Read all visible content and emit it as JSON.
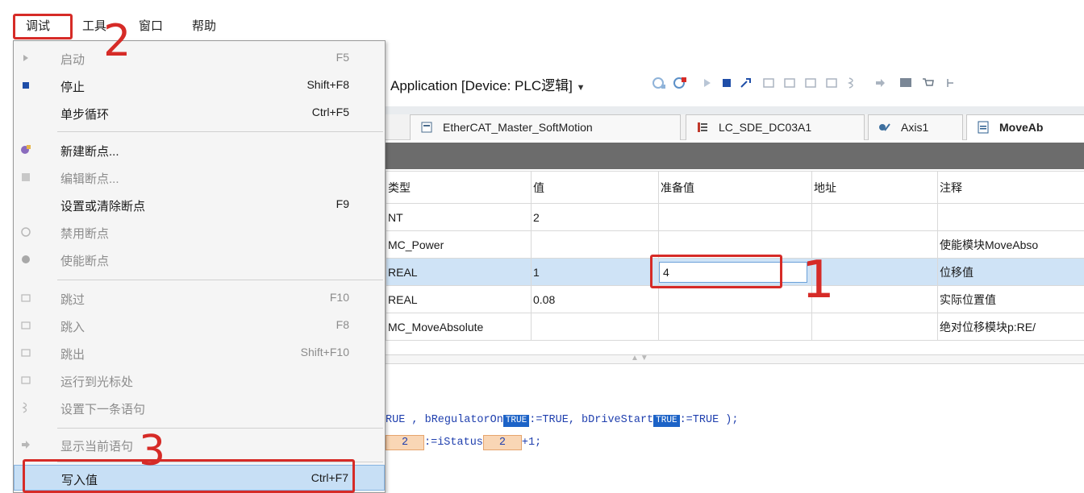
{
  "menubar": {
    "items": [
      "调试",
      "工具",
      "窗口",
      "帮助"
    ]
  },
  "toolbar": {
    "app_label": "Application [Device: PLC逻辑]"
  },
  "tabs": [
    {
      "label": "EtherCAT_Master_SoftMotion"
    },
    {
      "label": "LC_SDE_DC03A1"
    },
    {
      "label": "Axis1"
    },
    {
      "label": "MoveAb"
    }
  ],
  "watch": {
    "headers": [
      "类型",
      "值",
      "准备值",
      "地址",
      "注释"
    ],
    "rows": [
      {
        "type": "NT",
        "value": "2",
        "prepared": "",
        "address": "",
        "comment": ""
      },
      {
        "type": "MC_Power",
        "value": "",
        "prepared": "",
        "address": "",
        "comment": "使能模块MoveAbso"
      },
      {
        "type": "REAL",
        "value": "1",
        "prepared": "4",
        "address": "",
        "comment": "位移值"
      },
      {
        "type": "REAL",
        "value": "0.08",
        "prepared": "",
        "address": "",
        "comment": "实际位置值"
      },
      {
        "type": "MC_MoveAbsolute",
        "value": "",
        "prepared": "",
        "address": "",
        "comment": "绝对位移模块p:RE/"
      }
    ]
  },
  "code": {
    "line1_a": "RUE , bRegulatorOn",
    "line1_tag1": "TRUE",
    "line1_b": ":=TRUE, bDriveStart",
    "line1_tag2": "TRUE",
    "line1_c": ":=TRUE );",
    "line2_val1": "2",
    "line2_mid": ":=iStatus",
    "line2_val2": "2",
    "line2_end": "+1;"
  },
  "dropdown": {
    "items": [
      {
        "label": "启动",
        "shortcut": "F5",
        "disabled": true,
        "icon": "play-icon"
      },
      {
        "label": "停止",
        "shortcut": "Shift+F8",
        "disabled": false,
        "icon": "stop-icon"
      },
      {
        "label": "单步循环",
        "shortcut": "Ctrl+F5",
        "disabled": false,
        "icon": ""
      },
      {
        "label": "新建断点...",
        "shortcut": "",
        "disabled": false,
        "icon": "new-breakpoint-icon"
      },
      {
        "label": "编辑断点...",
        "shortcut": "",
        "disabled": true,
        "icon": "edit-breakpoint-icon"
      },
      {
        "label": "设置或清除断点",
        "shortcut": "F9",
        "disabled": false,
        "icon": ""
      },
      {
        "label": "禁用断点",
        "shortcut": "",
        "disabled": true,
        "icon": "disable-breakpoint-icon"
      },
      {
        "label": "使能断点",
        "shortcut": "",
        "disabled": true,
        "icon": "enable-breakpoint-icon"
      },
      {
        "label": "跳过",
        "shortcut": "F10",
        "disabled": true,
        "icon": "step-over-icon"
      },
      {
        "label": "跳入",
        "shortcut": "F8",
        "disabled": true,
        "icon": "step-into-icon"
      },
      {
        "label": "跳出",
        "shortcut": "Shift+F10",
        "disabled": true,
        "icon": "step-out-icon"
      },
      {
        "label": "运行到光标处",
        "shortcut": "",
        "disabled": true,
        "icon": "run-to-cursor-icon"
      },
      {
        "label": "设置下一条语句",
        "shortcut": "",
        "disabled": true,
        "icon": "set-next-statement-icon"
      },
      {
        "label": "显示当前语句",
        "shortcut": "",
        "disabled": true,
        "icon": "show-current-statement-icon"
      },
      {
        "label": "写入值",
        "shortcut": "Ctrl+F7",
        "disabled": false,
        "icon": ""
      }
    ]
  },
  "annotations": {
    "num1": "1",
    "num2": "2",
    "num3": "3",
    "color": "#d62b27"
  }
}
